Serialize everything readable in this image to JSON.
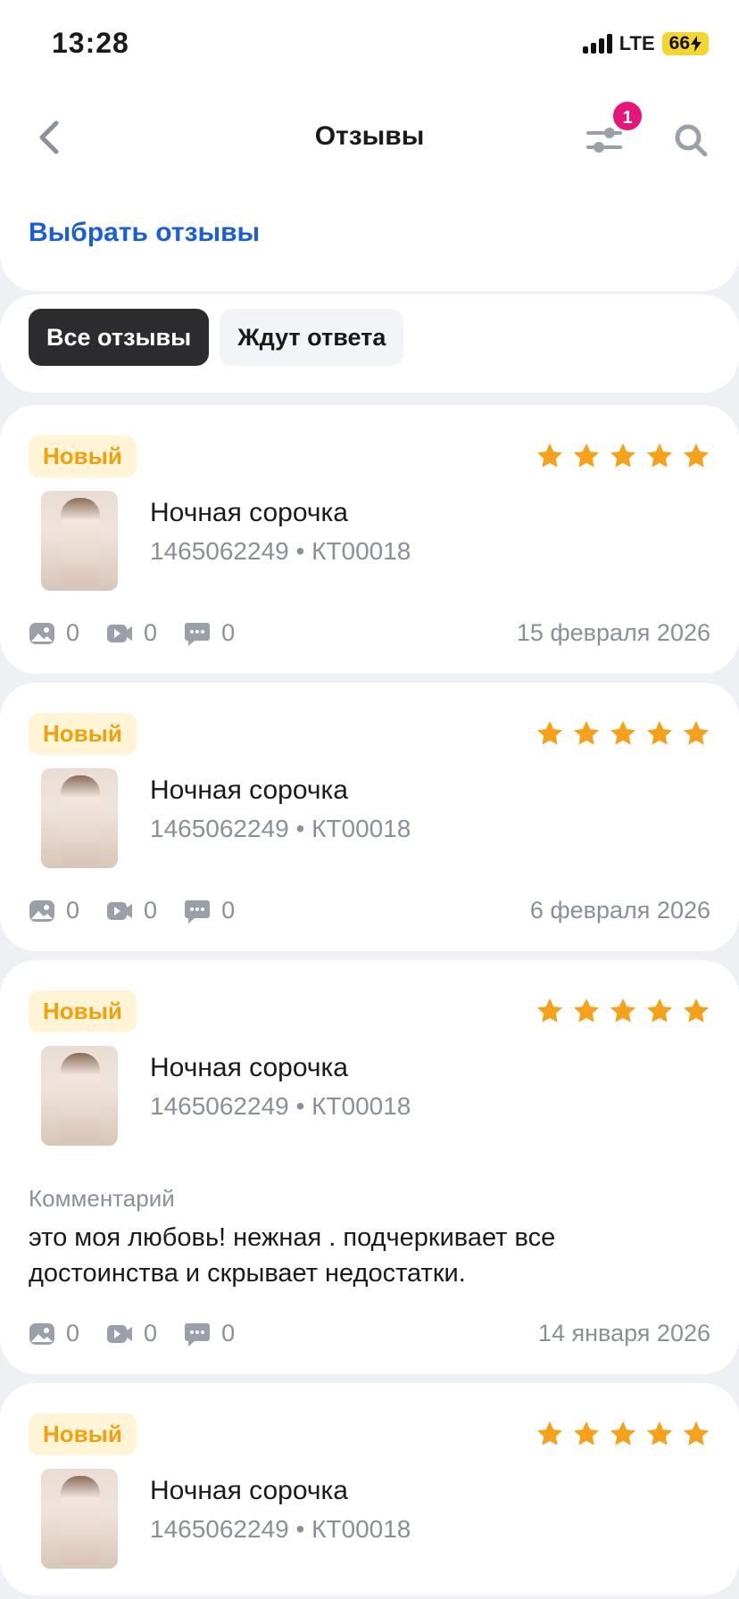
{
  "status_bar": {
    "time": "13:28",
    "network": "LTE",
    "battery": "66"
  },
  "nav": {
    "title": "Отзывы",
    "filter_badge": "1"
  },
  "select_label": "Выбрать отзывы",
  "segments": [
    {
      "label": "Все отзывы",
      "active": true
    },
    {
      "label": "Ждут ответа",
      "active": false
    }
  ],
  "reviews": [
    {
      "badge": "Новый",
      "rating": 5,
      "product_name": "Ночная сорочка",
      "product_meta": "1465062249 • КТ00018",
      "photos": "0",
      "videos": "0",
      "comments": "0",
      "date": "15 февраля 2026"
    },
    {
      "badge": "Новый",
      "rating": 5,
      "product_name": "Ночная сорочка",
      "product_meta": "1465062249 • КТ00018",
      "photos": "0",
      "videos": "0",
      "comments": "0",
      "date": "6 февраля 2026"
    },
    {
      "badge": "Новый",
      "rating": 5,
      "product_name": "Ночная сорочка",
      "product_meta": "1465062249 • КТ00018",
      "comment_label": "Комментарий",
      "comment_text": "это моя любовь! нежная . подчеркивает все достоинства и скрывает недостатки.",
      "photos": "0",
      "videos": "0",
      "comments": "0",
      "date": "14 января 2026"
    },
    {
      "badge": "Новый",
      "rating": 5,
      "product_name": "Ночная сорочка",
      "product_meta": "1465062249 • КТ00018"
    }
  ],
  "colors": {
    "accent_link": "#1a5fd8",
    "star": "#f7a11a",
    "badge_bg": "#fff4d6",
    "badge_text": "#f2a10b",
    "filter_badge": "#e7157a"
  }
}
